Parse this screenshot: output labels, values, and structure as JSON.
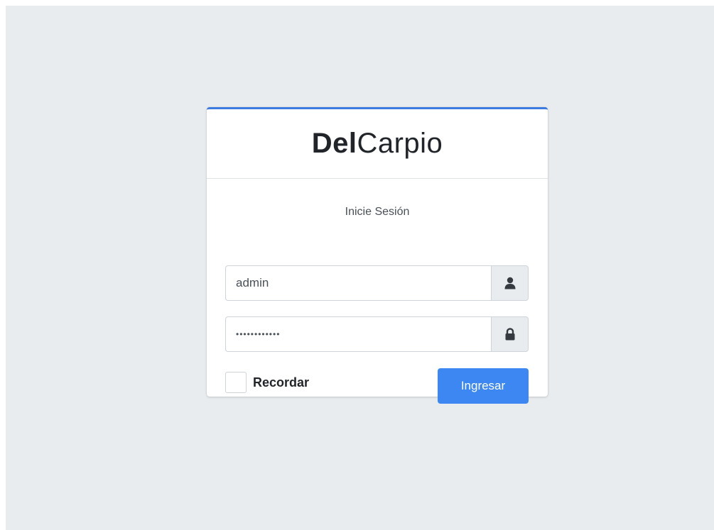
{
  "brand": {
    "bold": "Del",
    "light": "Carpio"
  },
  "login": {
    "message": "Inicie Sesión",
    "username_value": "admin",
    "username_icon": "user-icon",
    "password_value": "••••••••••••",
    "password_icon": "lock-icon",
    "remember_label": "Recordar",
    "remember_checked": false,
    "submit_label": "Ingresar"
  },
  "colors": {
    "background": "#e9ecef",
    "card_top_border": "#3c7ce0",
    "primary_button": "#3c87f2",
    "addon_background": "#e9ecef"
  }
}
